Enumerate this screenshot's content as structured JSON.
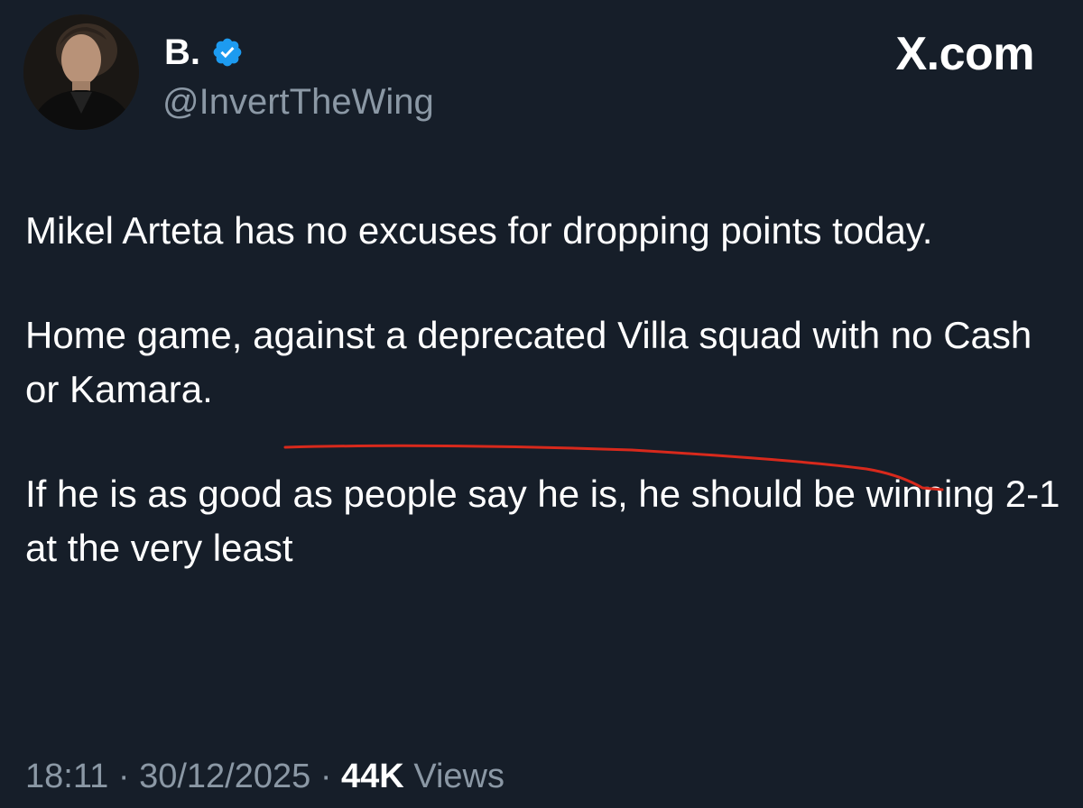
{
  "header": {
    "display_name": "B.",
    "handle": "@InvertTheWing",
    "site": "X.com",
    "verified": true,
    "avatar": "profile-photo",
    "verified_icon": "verified-badge-icon"
  },
  "tweet": {
    "paragraphs": [
      "Mikel Arteta has no excuses for dropping points today.",
      "Home game, against a deprecated Villa squad with no Cash or Kamara.",
      "If he is as good as people say he is, he should be winning 2-1 at the very least"
    ]
  },
  "meta": {
    "time": "18:11",
    "separator": "·",
    "date": "30/12/2025",
    "views_count": "44K",
    "views_label": "Views"
  },
  "colors": {
    "background": "#161e29",
    "text": "#ffffff",
    "muted": "#8b98a5",
    "verified": "#1d9bf0",
    "annotation": "#d8291c"
  }
}
